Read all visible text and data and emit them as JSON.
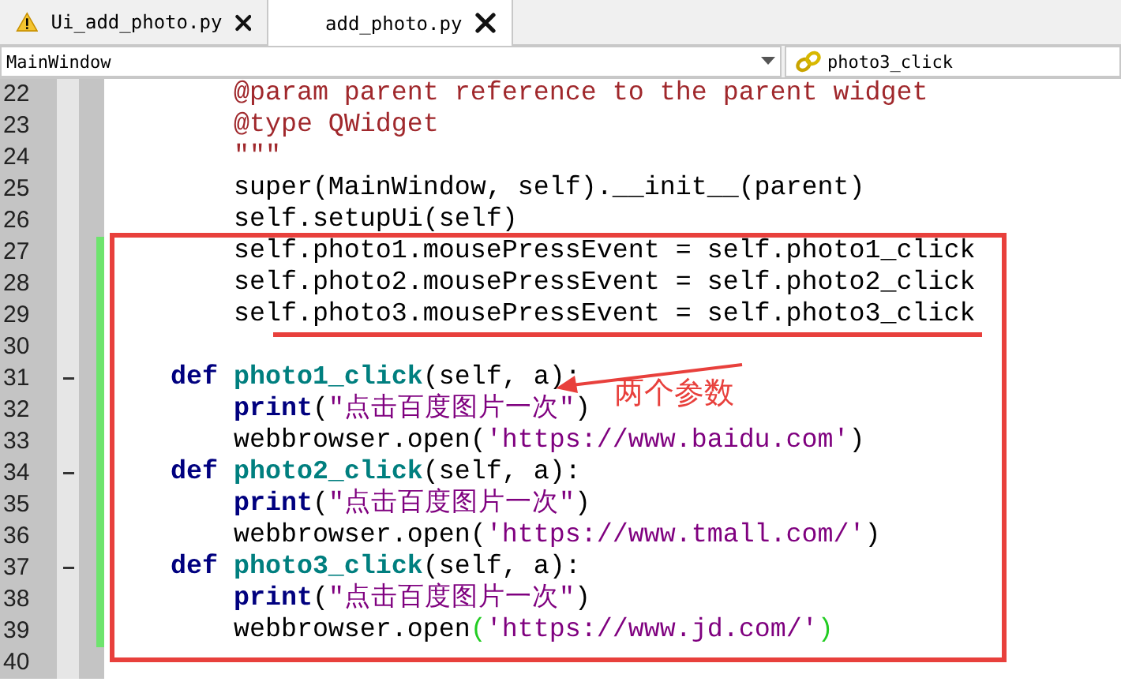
{
  "tabs": [
    {
      "label": "Ui_add_photo.py",
      "selected": false,
      "warning": true
    },
    {
      "label": "add_photo.py",
      "selected": true,
      "warning": false
    }
  ],
  "location": {
    "class_box": "MainWindow",
    "method_box": "photo3_click"
  },
  "editor": {
    "lines": [
      {
        "number": "22",
        "fold": false,
        "changed": false,
        "segments": [
          {
            "kind": "doc",
            "text": "        @param parent reference to the parent widget"
          }
        ]
      },
      {
        "number": "23",
        "fold": false,
        "changed": false,
        "segments": [
          {
            "kind": "doc",
            "text": "        @type QWidget"
          }
        ]
      },
      {
        "number": "24",
        "fold": false,
        "changed": false,
        "segments": [
          {
            "kind": "doc",
            "text": "        \"\"\""
          }
        ]
      },
      {
        "number": "25",
        "fold": false,
        "changed": false,
        "segments": [
          {
            "kind": "plain",
            "text": "        super(MainWindow, self).__init__(parent)"
          }
        ]
      },
      {
        "number": "26",
        "fold": false,
        "changed": false,
        "segments": [
          {
            "kind": "plain",
            "text": "        self.setupUi(self)"
          }
        ]
      },
      {
        "number": "27",
        "fold": false,
        "changed": true,
        "segments": [
          {
            "kind": "plain",
            "text": "        self.photo1.mousePressEvent = self.photo1_click"
          }
        ]
      },
      {
        "number": "28",
        "fold": false,
        "changed": true,
        "segments": [
          {
            "kind": "plain",
            "text": "        self.photo2.mousePressEvent = self.photo2_click"
          }
        ]
      },
      {
        "number": "29",
        "fold": false,
        "changed": true,
        "segments": [
          {
            "kind": "plain",
            "text": "        self.photo3.mousePressEvent = self.photo3_click"
          }
        ]
      },
      {
        "number": "30",
        "fold": false,
        "changed": true
      },
      {
        "number": "31",
        "fold": true,
        "changed": true,
        "segments": [
          {
            "kind": "keyword",
            "text": "    def"
          },
          {
            "kind": "name",
            "text": " photo1_click"
          },
          {
            "kind": "plain",
            "text": "(self, a):"
          }
        ]
      },
      {
        "number": "32",
        "fold": false,
        "changed": true,
        "segments": [
          {
            "kind": "keyword",
            "text": "        print"
          },
          {
            "kind": "plain",
            "text": "("
          },
          {
            "kind": "string",
            "text": "\"点击百度图片一次\""
          },
          {
            "kind": "plain",
            "text": ")"
          }
        ]
      },
      {
        "number": "33",
        "fold": false,
        "changed": true,
        "segments": [
          {
            "kind": "plain",
            "text": "        webbrowser.open("
          },
          {
            "kind": "string",
            "text": "'https://www.baidu.com'"
          },
          {
            "kind": "plain",
            "text": ")"
          }
        ]
      },
      {
        "number": "34",
        "fold": true,
        "changed": true,
        "segments": [
          {
            "kind": "keyword",
            "text": "    def"
          },
          {
            "kind": "name",
            "text": " photo2_click"
          },
          {
            "kind": "plain",
            "text": "(self, a):"
          }
        ]
      },
      {
        "number": "35",
        "fold": false,
        "changed": true,
        "segments": [
          {
            "kind": "keyword",
            "text": "        print"
          },
          {
            "kind": "plain",
            "text": "("
          },
          {
            "kind": "string",
            "text": "\"点击百度图片一次\""
          },
          {
            "kind": "plain",
            "text": ")"
          }
        ]
      },
      {
        "number": "36",
        "fold": false,
        "changed": true,
        "segments": [
          {
            "kind": "plain",
            "text": "        webbrowser.open("
          },
          {
            "kind": "string",
            "text": "'https://www.tmall.com/'"
          },
          {
            "kind": "plain",
            "text": ")"
          }
        ]
      },
      {
        "number": "37",
        "fold": true,
        "changed": true,
        "segments": [
          {
            "kind": "keyword",
            "text": "    def"
          },
          {
            "kind": "name",
            "text": " photo3_click"
          },
          {
            "kind": "plain",
            "text": "(self, a):"
          }
        ]
      },
      {
        "number": "38",
        "fold": false,
        "changed": true,
        "segments": [
          {
            "kind": "keyword",
            "text": "        print"
          },
          {
            "kind": "plain",
            "text": "("
          },
          {
            "kind": "string",
            "text": "\"点击百度图片一次\""
          },
          {
            "kind": "plain",
            "text": ")"
          }
        ]
      },
      {
        "number": "39",
        "fold": false,
        "changed": true,
        "segments": [
          {
            "kind": "plain",
            "text": "        webbrowser.open"
          },
          {
            "kind": "match",
            "text": "("
          },
          {
            "kind": "string",
            "text": "'https://www.jd.com/'"
          },
          {
            "kind": "match",
            "text": ")"
          }
        ]
      },
      {
        "number": "40",
        "fold": false,
        "changed": false
      }
    ]
  },
  "annotation": {
    "label": "两个参数"
  }
}
